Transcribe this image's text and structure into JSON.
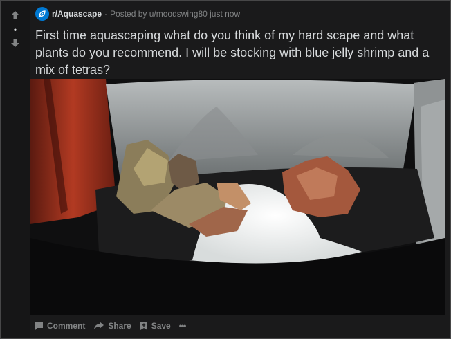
{
  "vote": {
    "score": "•"
  },
  "post": {
    "subreddit": "r/Aquascape",
    "posted_by": "Posted by u/moodswing80 just now",
    "title": "First time aquascaping what do you think of my hard scape and what plants do you recommend. I will be stocking with blue jelly shrimp and a mix of tetras?"
  },
  "actions": {
    "comment": "Comment",
    "share": "Share",
    "save": "Save",
    "more": "•••"
  },
  "colors": {
    "background": "#1a1a1b",
    "text": "#d7dadc",
    "muted": "#818384",
    "subreddit_icon": "#0079d3"
  }
}
